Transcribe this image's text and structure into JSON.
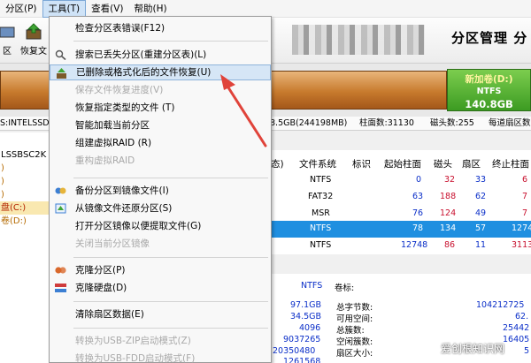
{
  "menubar": {
    "items": [
      "分区(P)",
      "工具(T)",
      "查看(V)",
      "帮助(H)"
    ]
  },
  "toolbar": {
    "items": [
      "区",
      "恢复文"
    ],
    "brand": "分区管理 分"
  },
  "disk": {
    "volume_name": "新加卷(D:)",
    "filesystem": "NTFS",
    "size": "140.8GB"
  },
  "info_strip": {
    "left": "S:INTELSSD",
    "capacity": "8.5GB(244198MB)",
    "cylinders": "柱面数:31130",
    "heads": "磁头数:255",
    "sectors": "每道扇区数"
  },
  "tree": {
    "items": [
      "LSSBSC2K",
      ")",
      ")",
      ")",
      "盘(C:)",
      "卷(D:)"
    ]
  },
  "table": {
    "headers": [
      "态)",
      "文件系统",
      "标识",
      "起始柱面",
      "磁头",
      "扇区",
      "终止柱面"
    ],
    "rows": [
      {
        "fs": "NTFS",
        "start": "0",
        "head": "32",
        "sector": "33",
        "end": "6"
      },
      {
        "fs": "FAT32",
        "start": "63",
        "head": "188",
        "sector": "62",
        "end": "7"
      },
      {
        "fs": "MSR",
        "start": "76",
        "head": "124",
        "sector": "49",
        "end": "7"
      },
      {
        "fs": "NTFS",
        "start": "78",
        "head": "134",
        "sector": "57",
        "end": "1274"
      },
      {
        "fs": "NTFS",
        "start": "12748",
        "head": "86",
        "sector": "11",
        "end": "3113"
      }
    ]
  },
  "stats": {
    "fs": "NTFS",
    "volume_label": "卷标:",
    "values": [
      "97.1GB",
      "34.5GB",
      "4096",
      "9037265",
      "20350480",
      "1261568"
    ],
    "labels": [
      "总字节数:",
      "可用空间:",
      "总簇数:",
      "空闲簇数:",
      "扇区大小:"
    ],
    "right_values": [
      "104212725",
      "62.",
      "25442",
      "16405",
      "5"
    ]
  },
  "tools_menu": {
    "items": [
      {
        "label": "检查分区表错误(F12)",
        "enabled": true
      },
      {
        "label": "搜索已丢失分区(重建分区表)(L)",
        "enabled": true
      },
      {
        "label": "已删除或格式化后的文件恢复(U)",
        "enabled": true
      },
      {
        "label": "保存文件恢复进度(V)",
        "enabled": false
      },
      {
        "label": "恢复指定类型的文件 (T)",
        "enabled": true
      },
      {
        "label": "智能加载当前分区",
        "enabled": true
      },
      {
        "label": "组建虚拟RAID (R)",
        "enabled": true
      },
      {
        "label": "重构虚拟RAID",
        "enabled": false
      },
      {
        "label": "备份分区到镜像文件(I)",
        "enabled": true
      },
      {
        "label": "从镜像文件还原分区(S)",
        "enabled": true
      },
      {
        "label": "打开分区镜像以便提取文件(G)",
        "enabled": true
      },
      {
        "label": "关闭当前分区镜像",
        "enabled": false
      },
      {
        "label": "克隆分区(P)",
        "enabled": true
      },
      {
        "label": "克隆硬盘(D)",
        "enabled": true
      },
      {
        "label": "清除扇区数据(E)",
        "enabled": true
      },
      {
        "label": "转换为USB-ZIP启动模式(Z)",
        "enabled": false
      },
      {
        "label": "转换为USB-FDD启动模式(F)",
        "enabled": false
      }
    ]
  },
  "watermark": "爱创根知识网",
  "colors": {
    "highlight_blue": "#1f8fe0",
    "arrow_red": "#e0433a",
    "disk_orange": "#c77a2d",
    "disk_green": "#3c9b22"
  }
}
